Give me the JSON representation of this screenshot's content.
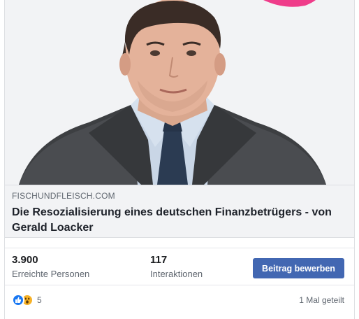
{
  "link_preview": {
    "domain": "FISCHUNDFLEISCH.COM",
    "title": "Die Resozialisierung eines deutschen Finanzbetrügers - von Gerald Loacker"
  },
  "stats": {
    "reach_value": "3.900",
    "reach_label": "Erreichte Personen",
    "interactions_value": "117",
    "interactions_label": "Interaktionen"
  },
  "boost_button": {
    "label": "Beitrag bewerben"
  },
  "reactions": {
    "icons": [
      "thumbs-up-icon",
      "wow-icon"
    ],
    "count": "5",
    "shares": "1 Mal geteilt"
  },
  "colors": {
    "boost_button": "#4267b2",
    "like": "#1877f2",
    "wow": "#f7b125",
    "link_box_bg": "#f2f3f5"
  }
}
